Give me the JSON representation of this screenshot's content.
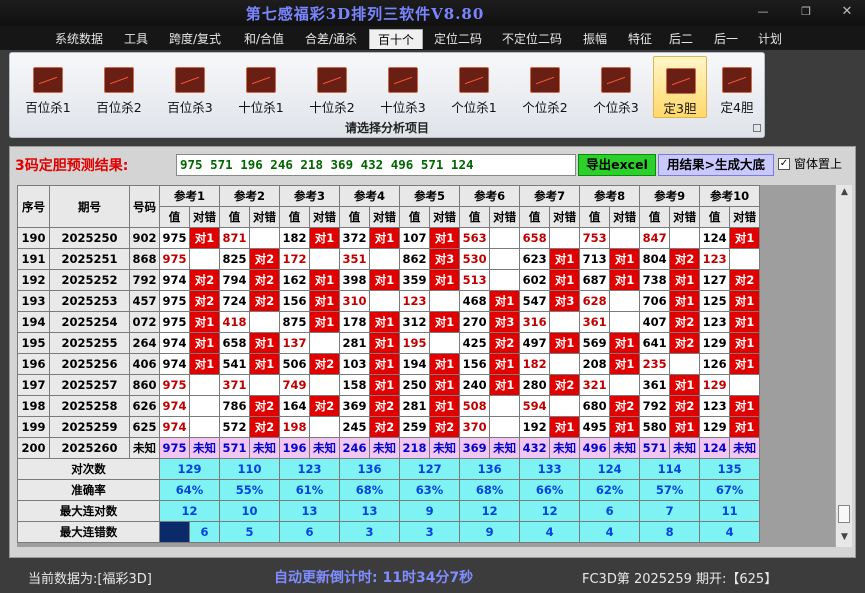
{
  "window": {
    "title": "第七感福彩3D排列三软件V8.80"
  },
  "menu": [
    "系统数据",
    "工具",
    "跨度/复式",
    "和/合值",
    "合差/通杀",
    "百十个",
    "定位二码",
    "不定位二码",
    "振幅",
    "特征",
    "后二",
    "后一",
    "计划"
  ],
  "menu_active": 5,
  "ribbon": {
    "buttons": [
      "百位杀1",
      "百位杀2",
      "百位杀3",
      "十位杀1",
      "十位杀2",
      "十位杀3",
      "个位杀1",
      "个位杀2",
      "个位杀3",
      "定3胆",
      "定4胆"
    ],
    "selected": 9,
    "footer": "请选择分析项目"
  },
  "prediction": {
    "label": "3码定胆预测结果:",
    "value": "975 571 196 246 218 369 432 496 571 124",
    "excel_button": "导出excel",
    "big_button": "用结果>生成大底",
    "ontop_checked": true,
    "ontop_label": "窗体置上"
  },
  "table": {
    "head_fixed": [
      "序号",
      "期号",
      "号码"
    ],
    "ref_headers": [
      "参考1",
      "参考2",
      "参考3",
      "参考4",
      "参考5",
      "参考6",
      "参考7",
      "参考8",
      "参考9",
      "参考10"
    ],
    "sub_value": "值",
    "sub_check": "对错",
    "rows": [
      {
        "seq": "190",
        "issue": "2025250",
        "num": "902",
        "refs": [
          [
            "975",
            "对1"
          ],
          [
            "871",
            ""
          ],
          [
            "182",
            "对1"
          ],
          [
            "372",
            "对1"
          ],
          [
            "107",
            "对1"
          ],
          [
            "563",
            ""
          ],
          [
            "658",
            ""
          ],
          [
            "753",
            ""
          ],
          [
            "847",
            ""
          ],
          [
            "124",
            "对1"
          ]
        ]
      },
      {
        "seq": "191",
        "issue": "2025251",
        "num": "868",
        "refs": [
          [
            "975",
            ""
          ],
          [
            "825",
            "对2"
          ],
          [
            "172",
            ""
          ],
          [
            "351",
            ""
          ],
          [
            "862",
            "对3"
          ],
          [
            "530",
            ""
          ],
          [
            "623",
            "对1"
          ],
          [
            "713",
            "对1"
          ],
          [
            "804",
            "对2"
          ],
          [
            "123",
            ""
          ]
        ]
      },
      {
        "seq": "192",
        "issue": "2025252",
        "num": "792",
        "refs": [
          [
            "974",
            "对2"
          ],
          [
            "794",
            "对2"
          ],
          [
            "162",
            "对1"
          ],
          [
            "398",
            "对1"
          ],
          [
            "359",
            "对1"
          ],
          [
            "513",
            ""
          ],
          [
            "602",
            "对1"
          ],
          [
            "687",
            "对1"
          ],
          [
            "738",
            "对1"
          ],
          [
            "127",
            "对2"
          ]
        ]
      },
      {
        "seq": "193",
        "issue": "2025253",
        "num": "457",
        "refs": [
          [
            "975",
            "对2"
          ],
          [
            "724",
            "对2"
          ],
          [
            "156",
            "对1"
          ],
          [
            "310",
            ""
          ],
          [
            "123",
            ""
          ],
          [
            "468",
            "对1"
          ],
          [
            "547",
            "对3"
          ],
          [
            "628",
            ""
          ],
          [
            "706",
            "对1"
          ],
          [
            "125",
            "对1"
          ]
        ]
      },
      {
        "seq": "194",
        "issue": "2025254",
        "num": "072",
        "refs": [
          [
            "975",
            "对1"
          ],
          [
            "418",
            ""
          ],
          [
            "875",
            "对1"
          ],
          [
            "178",
            "对1"
          ],
          [
            "312",
            "对1"
          ],
          [
            "270",
            "对3"
          ],
          [
            "316",
            ""
          ],
          [
            "361",
            ""
          ],
          [
            "407",
            "对2"
          ],
          [
            "123",
            "对1"
          ]
        ]
      },
      {
        "seq": "195",
        "issue": "2025255",
        "num": "264",
        "refs": [
          [
            "974",
            "对1"
          ],
          [
            "658",
            "对1"
          ],
          [
            "137",
            ""
          ],
          [
            "281",
            "对1"
          ],
          [
            "195",
            ""
          ],
          [
            "425",
            "对2"
          ],
          [
            "497",
            "对1"
          ],
          [
            "569",
            "对1"
          ],
          [
            "641",
            "对2"
          ],
          [
            "129",
            "对1"
          ]
        ]
      },
      {
        "seq": "196",
        "issue": "2025256",
        "num": "406",
        "refs": [
          [
            "974",
            "对1"
          ],
          [
            "541",
            "对1"
          ],
          [
            "506",
            "对2"
          ],
          [
            "103",
            "对1"
          ],
          [
            "194",
            "对1"
          ],
          [
            "156",
            "对1"
          ],
          [
            "182",
            ""
          ],
          [
            "208",
            "对1"
          ],
          [
            "235",
            ""
          ],
          [
            "126",
            "对1"
          ]
        ]
      },
      {
        "seq": "197",
        "issue": "2025257",
        "num": "860",
        "refs": [
          [
            "975",
            ""
          ],
          [
            "371",
            ""
          ],
          [
            "749",
            ""
          ],
          [
            "158",
            "对1"
          ],
          [
            "250",
            "对1"
          ],
          [
            "240",
            "对1"
          ],
          [
            "280",
            "对2"
          ],
          [
            "321",
            ""
          ],
          [
            "361",
            "对1"
          ],
          [
            "129",
            ""
          ]
        ]
      },
      {
        "seq": "198",
        "issue": "2025258",
        "num": "626",
        "refs": [
          [
            "974",
            ""
          ],
          [
            "786",
            "对2"
          ],
          [
            "164",
            "对2"
          ],
          [
            "369",
            "对2"
          ],
          [
            "281",
            "对1"
          ],
          [
            "508",
            ""
          ],
          [
            "594",
            ""
          ],
          [
            "680",
            "对2"
          ],
          [
            "792",
            "对2"
          ],
          [
            "123",
            "对1"
          ]
        ]
      },
      {
        "seq": "199",
        "issue": "2025259",
        "num": "625",
        "refs": [
          [
            "974",
            ""
          ],
          [
            "572",
            "对2"
          ],
          [
            "198",
            ""
          ],
          [
            "245",
            "对2"
          ],
          [
            "259",
            "对2"
          ],
          [
            "370",
            ""
          ],
          [
            "192",
            "对1"
          ],
          [
            "495",
            "对1"
          ],
          [
            "580",
            "对1"
          ],
          [
            "129",
            "对1"
          ]
        ]
      }
    ],
    "pred_row": {
      "seq": "200",
      "issue": "2025260",
      "num": "未知",
      "values": [
        "975",
        "571",
        "196",
        "246",
        "218",
        "369",
        "432",
        "496",
        "571",
        "124"
      ],
      "check": "未知"
    },
    "stats": [
      {
        "label": "对次数",
        "values": [
          "129",
          "110",
          "123",
          "136",
          "127",
          "136",
          "133",
          "124",
          "114",
          "135"
        ]
      },
      {
        "label": "准确率",
        "values": [
          "64%",
          "55%",
          "61%",
          "68%",
          "63%",
          "68%",
          "66%",
          "62%",
          "57%",
          "67%"
        ]
      },
      {
        "label": "最大连对数",
        "values": [
          "12",
          "10",
          "13",
          "13",
          "9",
          "12",
          "12",
          "6",
          "7",
          "11"
        ]
      },
      {
        "label": "最大连错数",
        "values": [
          "6",
          "5",
          "6",
          "3",
          "3",
          "9",
          "4",
          "4",
          "8",
          "4"
        ]
      }
    ]
  },
  "status": {
    "current": "当前数据为:[福彩3D]",
    "countdown": "自动更新倒计时:  11时34分7秒",
    "issue": "FC3D第 2025259 期开:【625】"
  }
}
